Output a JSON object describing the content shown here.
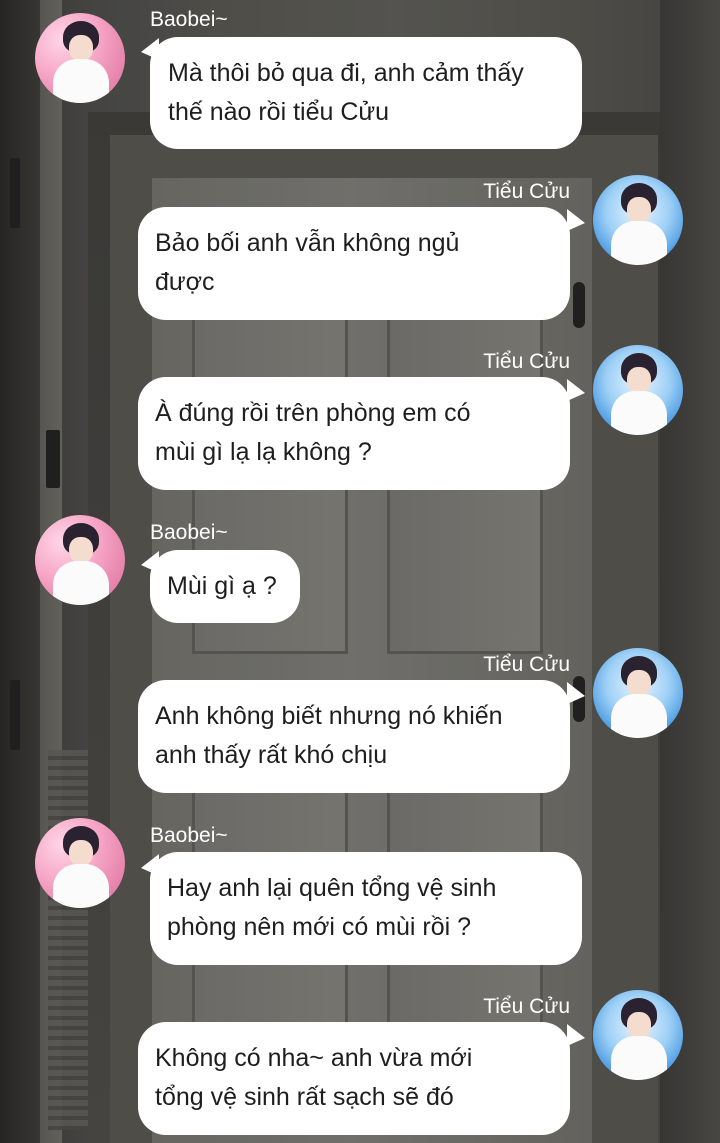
{
  "colors": {
    "bubble": "#ffffff",
    "text": "#1e1e1e",
    "name": "#ffffff",
    "avatar_baobei": "#f7a8c8",
    "avatar_tieucuu": "#3f93df"
  },
  "messages": [
    {
      "sender": "Baobei~",
      "side": "left",
      "avatar": "baobei-avatar-icon",
      "text": "Mà thôi bỏ qua đi, anh cảm thấy\nthế nào rồi tiểu Cửu"
    },
    {
      "sender": "Tiểu Cửu",
      "side": "right",
      "avatar": "tieu-cuu-avatar-icon",
      "text": "Bảo bối anh vẫn không ngủ\nđược"
    },
    {
      "sender": "Tiểu Cửu",
      "side": "right",
      "avatar": "tieu-cuu-avatar-icon",
      "text": "À đúng rồi trên phòng em có\nmùi gì lạ lạ không ?"
    },
    {
      "sender": "Baobei~",
      "side": "left",
      "avatar": "baobei-avatar-icon",
      "text": "Mùi gì ạ ?"
    },
    {
      "sender": "Tiểu Cửu",
      "side": "right",
      "avatar": "tieu-cuu-avatar-icon",
      "text": "Anh không biết nhưng nó khiến\nanh thấy rất khó chịu"
    },
    {
      "sender": "Baobei~",
      "side": "left",
      "avatar": "baobei-avatar-icon",
      "text": "Hay anh lại quên tổng vệ sinh\nphòng nên mới có mùi rồi ?"
    },
    {
      "sender": "Tiểu Cửu",
      "side": "right",
      "avatar": "tieu-cuu-avatar-icon",
      "text": "Không có nha~ anh vừa mới\ntổng vệ sinh rất sạch sẽ đó"
    }
  ]
}
